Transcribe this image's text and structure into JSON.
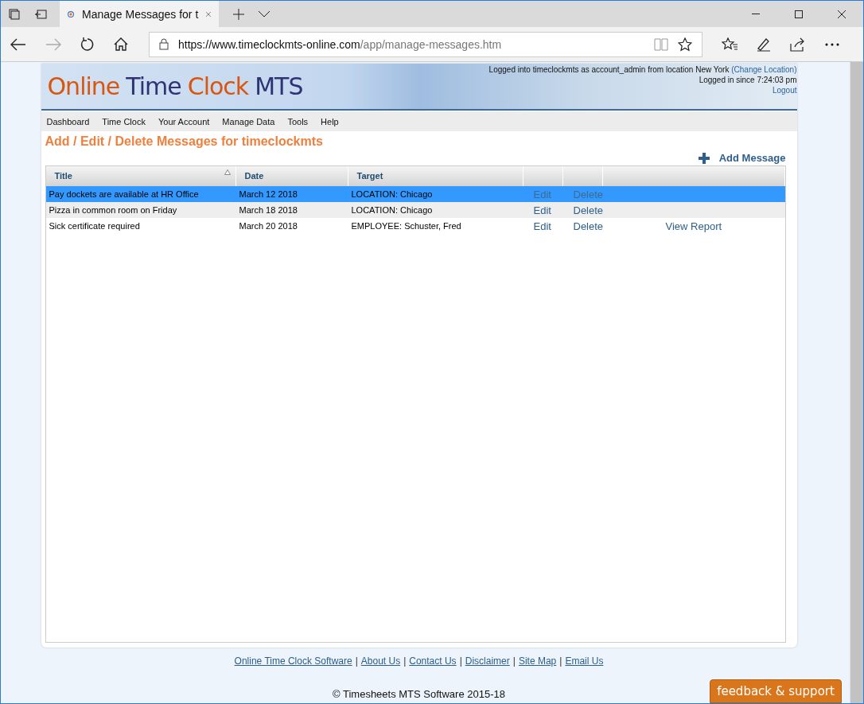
{
  "browser": {
    "tab_title": "Manage Messages for t",
    "url_host": "https://www.timeclockmts-online.com",
    "url_path": "/app/manage-messages.htm"
  },
  "header": {
    "logo": [
      {
        "text": "Online",
        "accent": true
      },
      {
        "text": "Time",
        "accent": false
      },
      {
        "text": "Clock",
        "accent": true
      },
      {
        "text": "MTS",
        "accent": false
      }
    ],
    "login_text": "Logged into timeclockmts as account_admin from location New York",
    "change_location": "(Change Location)",
    "since": "Logged in since 7:24:03 pm",
    "logout": "Logout"
  },
  "menu": [
    "Dashboard",
    "Time Clock",
    "Your Account",
    "Manage Data",
    "Tools",
    "Help"
  ],
  "heading": "Add / Edit / Delete Messages for timeclockmts",
  "add_button": "Add Message",
  "table": {
    "columns": [
      "Title",
      "Date",
      "Target"
    ],
    "rows": [
      {
        "title": "Pay dockets are available at HR Office",
        "date": "March 12 2018",
        "target": "LOCATION: Chicago",
        "edit": "Edit",
        "delete": "Delete",
        "selected": true
      },
      {
        "title": "Pizza in common room on Friday",
        "date": "March 18 2018",
        "target": "LOCATION: Chicago",
        "edit": "Edit",
        "delete": "Delete",
        "selected": false
      },
      {
        "title": "Sick certificate required",
        "date": "March 20 2018",
        "target": "EMPLOYEE: Schuster, Fred",
        "edit": "Edit",
        "delete": "Delete",
        "report": "View Report",
        "selected": false
      }
    ]
  },
  "footer": {
    "links": [
      "Online Time Clock Software",
      "About Us",
      "Contact Us",
      "Disclaimer",
      "Site Map",
      "Email Us"
    ],
    "separator": "|",
    "copyright": "© Timesheets MTS Software 2015-18"
  },
  "feedback": "feedback & support"
}
